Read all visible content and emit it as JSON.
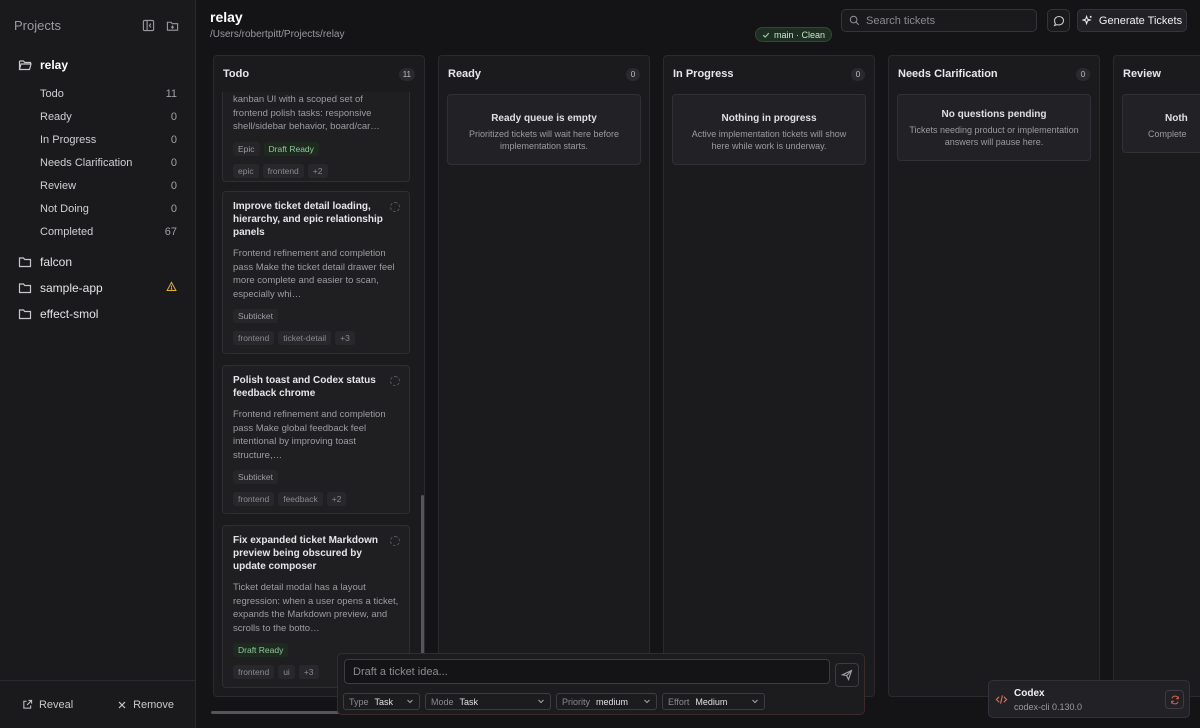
{
  "sidebar": {
    "title": "Projects",
    "projects": [
      {
        "name": "relay"
      },
      {
        "name": "falcon"
      },
      {
        "name": "sample-app"
      },
      {
        "name": "effect-smol"
      }
    ],
    "statuses": [
      {
        "label": "Todo",
        "count": "11"
      },
      {
        "label": "Ready",
        "count": "0"
      },
      {
        "label": "In Progress",
        "count": "0"
      },
      {
        "label": "Needs Clarification",
        "count": "0"
      },
      {
        "label": "Review",
        "count": "0"
      },
      {
        "label": "Not Doing",
        "count": "0"
      },
      {
        "label": "Completed",
        "count": "67"
      }
    ],
    "reveal_label": "Reveal",
    "remove_label": "Remove"
  },
  "header": {
    "title": "relay",
    "path": "/Users/robertpitt/Projects/relay",
    "branch": "main · Clean",
    "search_placeholder": "Search tickets",
    "generate_label": "Generate Tickets"
  },
  "columns": [
    {
      "title": "Todo",
      "count": "11"
    },
    {
      "title": "Ready",
      "count": "0",
      "empty_title": "Ready queue is empty",
      "empty_desc": "Prioritized tickets will wait here before implementation starts."
    },
    {
      "title": "In Progress",
      "count": "0",
      "empty_title": "Nothing in progress",
      "empty_desc": "Active implementation tickets will show here while work is underway."
    },
    {
      "title": "Needs Clarification",
      "count": "0",
      "empty_title": "No questions pending",
      "empty_desc": "Tickets needing product or implementation answers will pause here."
    },
    {
      "title": "Review",
      "empty_title": "Noth",
      "empty_desc": "Complete"
    }
  ],
  "cards": [
    {
      "desc": "kanban UI with a scoped set of frontend polish tasks: responsive shell/sidebar behavior, board/car…",
      "type": "Epic",
      "status": "Draft Ready",
      "labels": [
        "epic",
        "frontend",
        "+2"
      ]
    },
    {
      "title": "Improve ticket detail loading, hierarchy, and epic relationship panels",
      "desc": "Frontend refinement and completion pass Make the ticket detail drawer feel more complete and easier to scan, especially whi…",
      "type": "Subticket",
      "labels": [
        "frontend",
        "ticket-detail",
        "+3"
      ]
    },
    {
      "title": "Polish toast and Codex status feedback chrome",
      "desc": "Frontend refinement and completion pass Make global feedback feel intentional by improving toast structure,…",
      "type": "Subticket",
      "labels": [
        "frontend",
        "feedback",
        "+2"
      ]
    },
    {
      "title": "Fix expanded ticket Markdown preview being obscured by update composer",
      "desc": "Ticket detail modal has a layout regression: when a user opens a ticket, expands the Markdown preview, and scrolls to the botto…",
      "status": "Draft Ready",
      "labels": [
        "frontend",
        "ui",
        "+3"
      ]
    }
  ],
  "composer": {
    "placeholder": "Draft a ticket idea...",
    "type_label": "Type",
    "type_value": "Task",
    "mode_label": "Mode",
    "mode_value": "Task",
    "priority_label": "Priority",
    "priority_value": "medium",
    "effort_label": "Effort",
    "effort_value": "Medium"
  },
  "codex": {
    "name": "Codex",
    "version": "codex-cli 0.130.0"
  },
  "colors": {
    "background": "#141416",
    "accent_green": "#8fc898",
    "warning": "#e0b040",
    "codex_icon": "#e07050"
  }
}
